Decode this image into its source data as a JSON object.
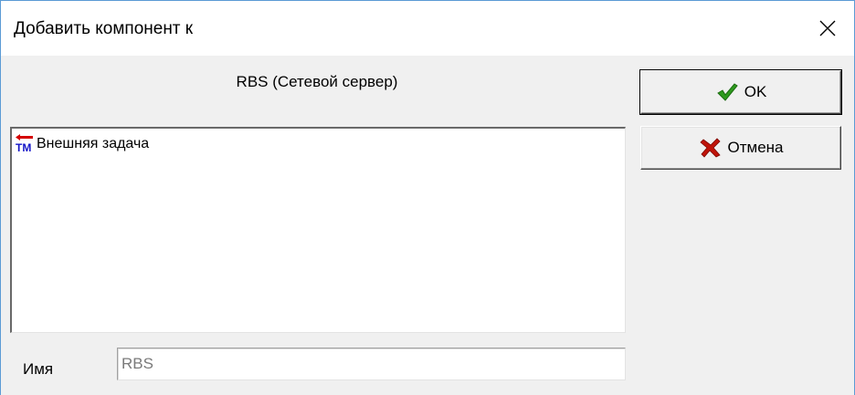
{
  "window": {
    "title": "Добавить компонент к"
  },
  "dialog": {
    "parent_component": "RBS (Сетевой сервер)",
    "buttons": {
      "ok_label": "OK",
      "cancel_label": "Отмена"
    },
    "component_list": {
      "items": [
        {
          "label": "Внешняя задача",
          "icon": "external-task-icon"
        }
      ]
    },
    "name_field": {
      "label": "Имя",
      "value": "RBS"
    }
  },
  "colors": {
    "ok_check": "#2e9a1e",
    "cancel_x": "#c0140a",
    "icon_red": "#d40000",
    "icon_blue": "#1414c8"
  }
}
